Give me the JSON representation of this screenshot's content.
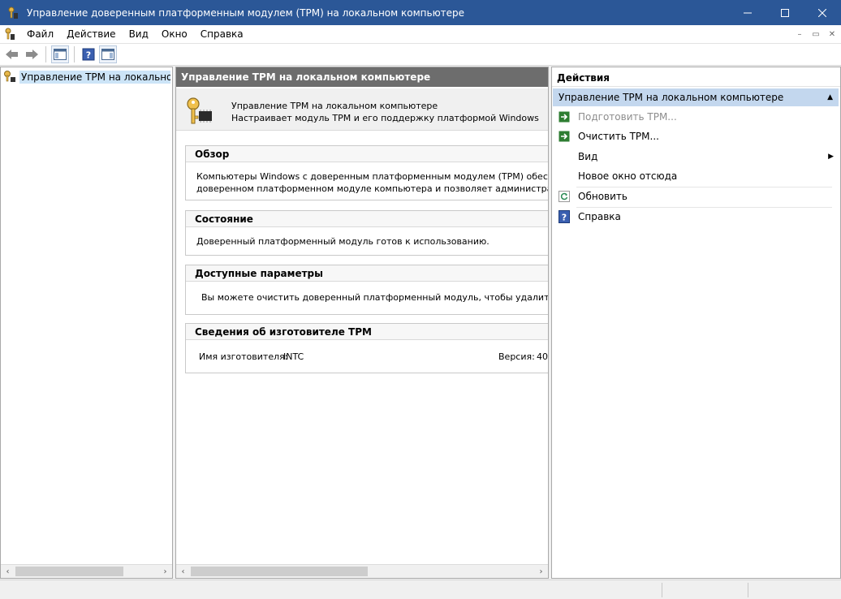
{
  "window": {
    "title": "Управление доверенным платформенным модулем (TPM) на локальном компьютере",
    "accent": "#2b5797"
  },
  "menu": {
    "file": "Файл",
    "action": "Действие",
    "view": "Вид",
    "window": "Окно",
    "help": "Справка"
  },
  "tree": {
    "root_label": "Управление TPM на локальном к"
  },
  "center": {
    "header": "Управление TPM на локальном компьютере",
    "intro_line1": "Управление TPM на локальном компьютере",
    "intro_line2": "Настраивает модуль TPM и его поддержку платформой Windows",
    "overview": {
      "title": "Обзор",
      "line1": "Компьютеры Windows с доверенным платформенным модулем (TPM) обеспечивают",
      "line2": "доверенном платформенном модуле компьютера и позволяет администраторам упр"
    },
    "status": {
      "title": "Состояние",
      "text": "Доверенный платформенный модуль готов к использованию."
    },
    "options": {
      "title": "Доступные параметры",
      "text": "Вы можете очистить доверенный платформенный модуль, чтобы удалить владельц"
    },
    "manufacturer": {
      "title": "Сведения об изготовителе TPM",
      "name_label": "Имя изготовителя:",
      "name_value": "INTC",
      "version_label": "Версия:",
      "version_value": "40"
    }
  },
  "actions": {
    "header": "Действия",
    "group": "Управление TPM на локальном компьютере",
    "items": {
      "prepare": "Подготовить TPM...",
      "clear": "Очистить TPM...",
      "view": "Вид",
      "new_window": "Новое окно отсюда",
      "refresh": "Обновить",
      "help": "Справка"
    }
  }
}
